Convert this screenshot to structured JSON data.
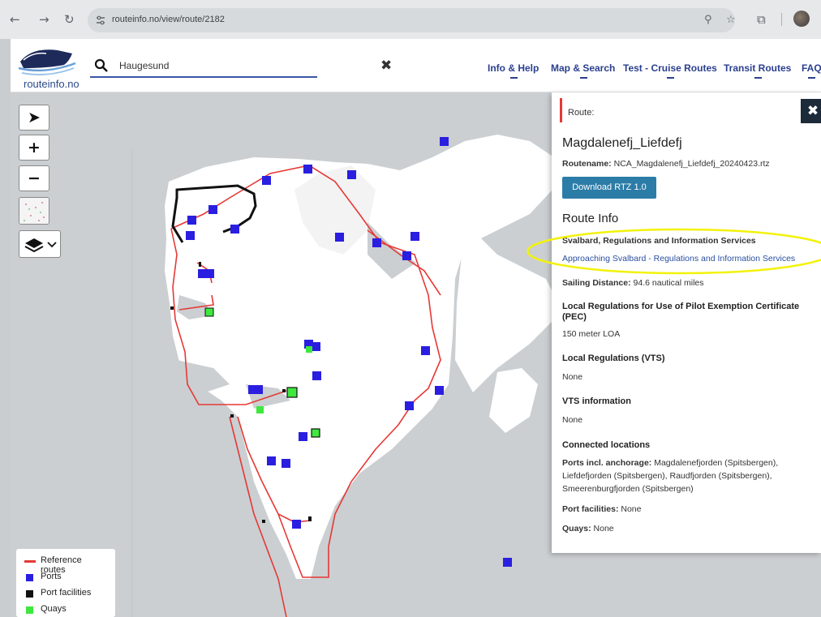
{
  "browser": {
    "url": "routeinfo.no/view/route/2182",
    "back_icon": "back-arrow-icon",
    "forward_icon": "forward-arrow-icon",
    "reload_icon": "reload-icon"
  },
  "header": {
    "logo_text": "routeinfo.no",
    "search": {
      "value": "Haugesund",
      "placeholder": ""
    },
    "nav": [
      "Info & Help",
      "Map & Search",
      "Test - Cruise Routes",
      "Transit Routes",
      "FAQ"
    ]
  },
  "legend": {
    "items": [
      {
        "label": "Reference routes",
        "color": "#e53935",
        "kind": "line"
      },
      {
        "label": "Ports",
        "color": "#2a1ee0",
        "kind": "square"
      },
      {
        "label": "Port facilities",
        "color": "#111111",
        "kind": "square"
      },
      {
        "label": "Quays",
        "color": "#3ee83e",
        "kind": "square"
      }
    ]
  },
  "panel": {
    "route_label": "Route:",
    "title": "Magdalenefj_Liefdefj",
    "routename_label": "Routename:",
    "routename_value": "NCA_Magdalenefj_Liefdefj_20240423.rtz",
    "download_label": "Download RTZ 1.0",
    "route_info_title": "Route Info",
    "svalbard_heading": "Svalbard, Regulations and Information Services",
    "svalbard_link": "Approaching Svalbard - Regulations and Information Services",
    "sailing_label": "Sailing Distance:",
    "sailing_value": "94.6 nautical miles",
    "pec_heading": "Local Regulations for Use of Pilot Exemption Certificate (PEC)",
    "pec_value": "150 meter LOA",
    "vts_heading": "Local Regulations (VTS)",
    "vts_value": "None",
    "vts_info_heading": "VTS information",
    "vts_info_value": "None",
    "connected_heading": "Connected locations",
    "ports_label": "Ports incl. anchorage:",
    "ports_value_1": "Magdalenefjorden (Spitsbergen),",
    "ports_value_2": "Liefdefjorden (Spitsbergen), Raudfjorden (Spitsbergen),",
    "ports_value_3": "Smeerenburgfjorden (Spitsbergen)",
    "facilities_label": "Port facilities:",
    "facilities_value": "None",
    "quays_label": "Quays:",
    "quays_value": "None"
  },
  "colors": {
    "route_red": "#e53935",
    "port_blue": "#2a1ee0",
    "quay_green": "#3ee83e",
    "highlight_yellow": "#f2f20a",
    "accent_button": "#2c7ca8"
  }
}
